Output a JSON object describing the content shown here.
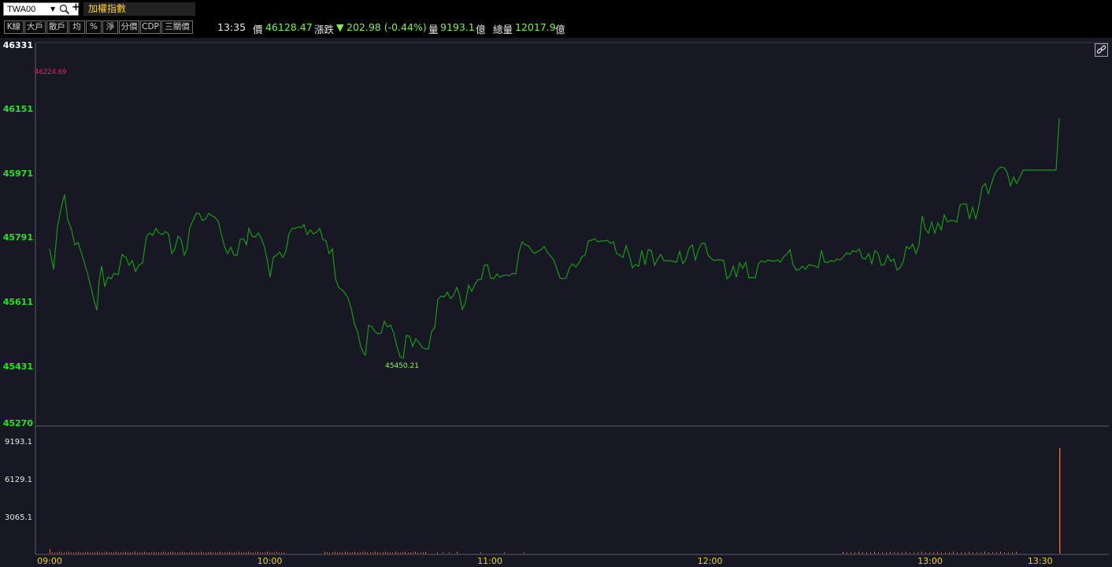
{
  "header": {
    "symbol": "TWA00",
    "index_name": "加權指數"
  },
  "toolbar": {
    "buttons": [
      "K線",
      "大戶",
      "散戶",
      "均",
      "%",
      "淨",
      "分價",
      "CDP",
      "三關價"
    ]
  },
  "quote": {
    "time": "13:35",
    "price_label": "價",
    "price": "46128.47",
    "change_label": "漲跌",
    "change_arrow": "▼",
    "change": "202.98 (-0.44%)",
    "volume_label": "量",
    "volume": "9193.1",
    "volume_unit": "億",
    "total_volume_label": "總量",
    "total_volume": "12017.9",
    "total_volume_unit": "億"
  },
  "icons": {
    "search": "search-icon",
    "dropdown": "chevron-down-icon",
    "add": "plus-icon",
    "link": "link-icon"
  },
  "colors": {
    "line": "#139a13",
    "axis_label": "#22e422",
    "high_label": "#e0206a",
    "low_label": "#8ff06a",
    "volume_bar": "#e86a2e",
    "time_label": "#e8d22a"
  },
  "chart_data": [
    {
      "type": "line",
      "x_range": [
        "09:00",
        "13:35"
      ],
      "xticks": [
        "09:00",
        "10:00",
        "11:00",
        "12:00",
        "13:00",
        "13:30"
      ],
      "yticks": [
        "46331",
        "46151",
        "45971",
        "45791",
        "45611",
        "45431",
        "45270"
      ],
      "ylim": [
        45270,
        46331
      ],
      "high_label": "46224.69",
      "low_label": "45450.21",
      "series": [
        {
          "t": [
            0,
            2,
            4,
            6,
            8,
            10,
            12,
            14,
            16,
            18,
            20,
            22,
            24,
            26,
            28,
            30,
            32,
            34,
            36,
            38,
            40,
            42,
            44,
            46,
            48,
            50,
            52,
            54,
            56,
            58,
            60,
            62,
            64,
            66,
            68,
            70,
            72,
            74,
            76,
            78,
            80,
            82,
            84,
            86,
            88,
            90,
            92,
            94,
            96,
            98,
            100,
            102,
            104,
            106,
            108,
            110,
            112,
            114,
            116,
            118,
            120,
            122,
            124,
            126,
            128,
            130,
            132,
            134,
            136,
            138,
            140,
            142,
            144,
            146,
            148,
            150,
            152,
            154,
            156,
            158,
            160,
            162,
            164,
            166,
            168,
            170,
            172,
            174,
            176,
            178,
            180,
            182,
            184,
            186,
            188,
            190,
            192,
            194,
            196,
            198,
            200,
            202,
            204,
            206,
            208,
            210,
            212,
            214,
            216,
            218,
            220,
            222,
            224,
            226,
            228,
            230,
            232,
            234,
            236,
            238,
            240,
            242,
            244,
            246,
            248,
            250,
            252,
            254,
            256,
            258,
            260,
            262,
            264,
            266,
            268,
            270,
            272,
            274,
            276,
            278,
            280,
            282,
            284,
            286,
            288,
            290,
            292,
            294,
            296,
            298,
            300,
            302,
            304,
            306,
            308,
            310,
            312,
            314,
            316,
            318,
            320,
            322,
            324,
            326,
            328,
            330,
            332,
            334,
            336,
            338,
            340,
            342,
            344,
            346,
            348,
            350,
            352,
            354,
            356,
            358,
            360,
            362,
            364,
            366,
            368,
            370,
            372,
            374,
            376,
            378,
            380,
            382,
            384,
            386,
            388,
            390,
            392,
            394,
            396,
            398,
            400,
            402,
            404,
            406,
            408,
            410,
            412,
            414,
            416,
            418,
            420,
            422,
            424,
            426,
            428,
            430,
            432,
            434,
            436,
            438,
            440,
            442,
            444,
            446,
            448,
            450,
            452,
            454,
            456,
            458,
            460,
            462,
            464,
            466,
            468,
            470,
            472,
            474,
            476,
            478,
            480,
            482,
            484,
            486,
            488,
            490,
            492,
            494,
            496,
            498,
            500,
            502,
            504,
            506,
            508,
            510,
            512,
            514,
            516,
            518,
            520,
            522,
            524,
            526,
            528,
            530,
            532,
            534,
            536,
            538,
            540,
            542,
            544,
            546,
            548,
            550,
            552,
            554,
            556,
            558,
            560,
            562,
            564,
            566,
            568,
            570,
            572,
            574,
            576,
            578,
            580,
            582,
            584,
            586,
            588,
            590,
            592,
            594,
            596,
            598,
            600,
            602,
            604,
            606,
            608,
            610,
            612,
            614,
            616,
            618,
            620,
            622,
            624,
            626,
            628,
            630,
            632,
            634,
            636,
            638,
            640,
            642,
            644,
            646,
            648,
            650,
            652,
            654,
            656,
            658,
            660,
            662,
            664,
            666,
            668,
            670,
            672,
            674,
            676,
            678,
            680,
            682,
            684,
            686,
            688,
            690,
            692,
            694,
            696,
            698,
            700,
            702,
            704,
            706,
            708,
            710,
            712,
            714,
            716,
            718,
            720,
            722,
            724,
            726,
            728,
            730,
            732,
            734,
            736,
            738,
            740,
            742,
            744,
            746,
            748,
            750,
            752,
            754,
            756,
            758,
            760,
            762,
            764,
            766,
            768,
            770,
            772,
            774,
            776,
            778,
            780,
            782,
            784,
            786,
            788,
            790,
            792,
            794,
            796,
            798,
            800,
            802,
            804,
            806,
            808,
            810,
            812,
            814,
            816,
            818,
            820,
            822,
            824,
            826,
            828,
            830,
            832,
            834,
            836,
            838,
            840,
            842,
            844,
            846,
            848,
            850,
            852,
            854,
            856,
            858,
            860,
            862,
            864,
            866,
            868,
            870,
            872,
            874,
            876,
            878,
            880,
            882,
            884,
            886,
            888,
            890,
            892,
            894,
            896,
            898,
            900,
            902,
            904,
            906,
            908,
            910,
            912,
            914,
            916,
            918,
            920,
            922,
            924,
            926,
            928,
            930,
            932,
            934,
            936,
            938,
            940,
            942,
            944,
            946,
            948,
            950,
            952,
            954,
            956,
            958,
            960,
            962,
            964,
            966,
            968,
            970,
            972,
            974,
            976,
            978,
            980,
            982,
            984,
            986,
            988,
            990,
            992,
            994,
            996,
            998,
            1000,
            1002,
            1004,
            1006,
            1008,
            1010,
            1012,
            1014,
            1016,
            1018,
            1020,
            1022,
            1024,
            1026,
            1028,
            1030,
            1032,
            1034,
            1036,
            1038,
            1040,
            1042,
            1044,
            1046,
            1048,
            1050,
            1052,
            1054,
            1056,
            1058,
            1060,
            1062,
            1064,
            1066,
            1068,
            1070,
            1072,
            1074,
            1076,
            1078,
            1080,
            1082,
            1084,
            1086,
            1088,
            1090,
            1092,
            1094,
            1096,
            1098,
            1100,
            1102,
            1104,
            1106,
            1108,
            1110,
            1112,
            1114,
            1116,
            1118,
            1120,
            1122,
            1124,
            1126,
            1128,
            1130,
            1132,
            1134,
            1136,
            1138,
            1140,
            1142,
            1144,
            1146,
            1148,
            1150,
            1152,
            1154,
            1156,
            1158,
            1160,
            1162,
            1164,
            1166,
            1168,
            1170,
            1172,
            1174,
            1176,
            1178,
            1180,
            1182,
            1184,
            1186,
            1188,
            1190,
            1192,
            1194,
            1196,
            1198,
            1200,
            1202,
            1204,
            1206,
            1208,
            1210,
            1212,
            1214,
            1216,
            1218,
            1220,
            1222,
            1224,
            1226,
            1228,
            1230,
            1232,
            1234,
            1236,
            1238,
            1240,
            1242,
            1244,
            1246,
            1248,
            1250,
            1252,
            1254,
            1256,
            1258,
            1260,
            1262,
            1264,
            1266,
            1268,
            1270,
            1272,
            1274,
            1276,
            1278,
            1280,
            1282,
            1284,
            1286,
            1288,
            1290,
            1292,
            1294,
            1296,
            1298,
            1300,
            1302,
            1304,
            1306,
            1308,
            1310,
            1312,
            1314,
            1316,
            1318,
            1320,
            1322,
            1324,
            1326,
            1328,
            1330,
            1332,
            1334,
            1336,
            1338,
            1340,
            1342,
            1344,
            1346,
            1348,
            1350,
            1352,
            1354,
            1356,
            1358,
            1360,
            1362,
            1364,
            1366,
            1368,
            1370,
            1372,
            1374,
            1376,
            1378,
            1380,
            1382,
            1384,
            1386,
            1388,
            1390,
            1392,
            1394,
            1396,
            1398,
            1400,
            1402,
            1404,
            1406,
            1408,
            1410,
            1412,
            1414,
            1416,
            1418,
            1420,
            1422,
            1424,
            1426,
            1428,
            1430,
            1432,
            1434,
            1436,
            1438,
            1440,
            1442,
            1444,
            1446,
            1448,
            1450,
            1452,
            1454,
            1456,
            1458,
            1460,
            1462,
            1464,
            1466,
            1468,
            1470,
            1472,
            1474,
            1476,
            1478,
            1480,
            1482,
            1484,
            1486,
            1488,
            1490,
            1492,
            1494,
            1496,
            1498,
            1500,
            1502,
            1504,
            1506,
            1508,
            1510,
            1512,
            1514,
            1516,
            1518,
            1520,
            1522,
            1524,
            1526,
            1528,
            1530,
            1532,
            1534,
            1536,
            1538,
            1540,
            1542,
            1544,
            1546,
            1548,
            1550,
            1552,
            1554,
            1556,
            1558,
            1560,
            1562,
            1564,
            1566,
            1568,
            1570,
            1572,
            1574,
            1576,
            1578,
            1580,
            1582,
            1584,
            1586,
            1588,
            1590,
            1592,
            1594,
            1596,
            1598,
            1600,
            1602,
            1604,
            1606,
            1608,
            1610,
            1612,
            1614,
            1616,
            1618,
            1620,
            1622,
            1624,
            1626,
            1628,
            1630,
            1632,
            1634,
            1636,
            1638,
            1640,
            1642,
            1644,
            1646,
            1648,
            1650
          ]
        }
      ],
      "points": [
        [
          0,
          45730
        ],
        [
          2,
          45673
        ],
        [
          4,
          45802
        ],
        [
          6,
          45850
        ],
        [
          8,
          45883
        ],
        [
          10,
          45822
        ],
        [
          12,
          45804
        ],
        [
          14,
          45749
        ],
        [
          16,
          45754
        ],
        [
          18,
          45730
        ],
        [
          20,
          45704
        ],
        [
          22,
          45660
        ],
        [
          24,
          45637
        ],
        [
          26,
          45673
        ],
        [
          28,
          45720
        ],
        [
          30,
          45667
        ],
        [
          32,
          45680
        ],
        [
          34,
          45691
        ],
        [
          36,
          45688
        ],
        [
          38,
          45721
        ],
        [
          40,
          45716
        ],
        [
          42,
          45696
        ],
        [
          44,
          45710
        ],
        [
          46,
          45727
        ],
        [
          48,
          45784
        ],
        [
          50,
          45788
        ],
        [
          52,
          45782
        ],
        [
          54,
          45798
        ],
        [
          56,
          45781
        ],
        [
          58,
          45788
        ],
        [
          60,
          45788
        ],
        [
          62,
          45735
        ],
        [
          64,
          45744
        ],
        [
          66,
          45783
        ],
        [
          68,
          45839
        ],
        [
          70,
          45848
        ],
        [
          72,
          45836
        ],
        [
          74,
          45839
        ],
        [
          76,
          45846
        ],
        [
          78,
          45816
        ],
        [
          80,
          45797
        ],
        [
          82,
          45740
        ],
        [
          84,
          45752
        ],
        [
          86,
          45775
        ],
        [
          88,
          45771
        ],
        [
          90,
          45755
        ],
        [
          92,
          45787
        ],
        [
          94,
          45814
        ],
        [
          96,
          45798
        ],
        [
          98,
          45775
        ],
        [
          100,
          45750
        ],
        [
          102,
          45700
        ],
        [
          104,
          45725
        ],
        [
          106,
          45769
        ],
        [
          108,
          45769
        ],
        [
          110,
          45783
        ],
        [
          112,
          45782
        ],
        [
          114,
          45797
        ],
        [
          116,
          45789
        ],
        [
          118,
          45805
        ],
        [
          120,
          45800
        ]
      ],
      "volume_axis": {
        "yticks": [
          "9193.1",
          "6129.1",
          "3065.1"
        ],
        "ylim": [
          0,
          10000
        ]
      },
      "volume_spike": {
        "time": "13:35",
        "value": 9193.1
      }
    }
  ]
}
